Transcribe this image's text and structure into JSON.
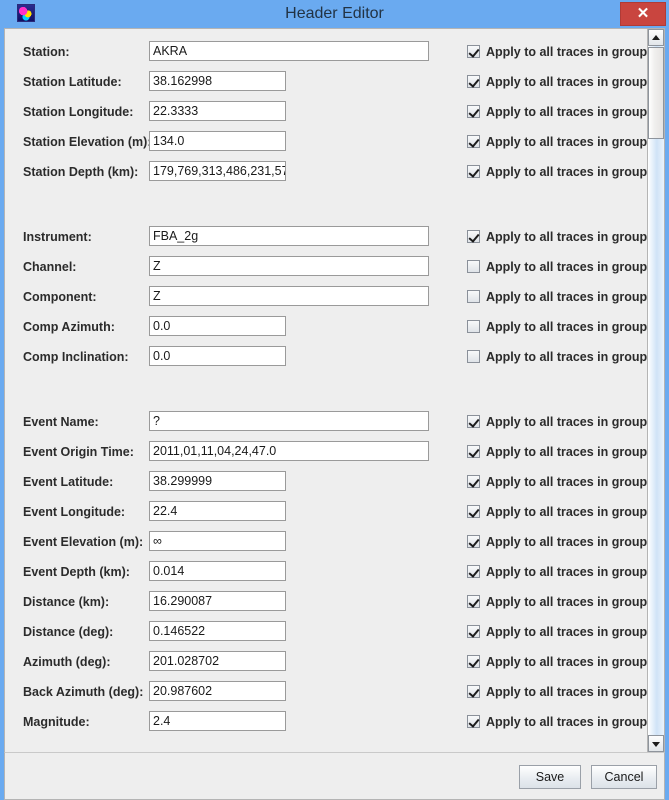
{
  "window": {
    "title": "Header Editor",
    "app_icon": "app-icon",
    "close_label": "✕"
  },
  "checkbox_label": "Apply to all traces in group",
  "sections": [
    {
      "name": "station",
      "rows": [
        {
          "label": "Station:",
          "value": "AKRA",
          "width": "wide",
          "checked": true
        },
        {
          "label": "Station Latitude:",
          "value": "38.162998",
          "width": "narrow",
          "checked": true
        },
        {
          "label": "Station Longitude:",
          "value": "22.3333",
          "width": "narrow",
          "checked": true
        },
        {
          "label": "Station Elevation (m):",
          "value": "134.0",
          "width": "narrow",
          "checked": true
        },
        {
          "label": "Station Depth (km):",
          "value": "179,769,313,486,231,57",
          "width": "narrow",
          "checked": true
        }
      ]
    },
    {
      "name": "instrument",
      "rows": [
        {
          "label": "Instrument:",
          "value": "FBA_2g",
          "width": "wide",
          "checked": true
        },
        {
          "label": "Channel:",
          "value": "Z",
          "width": "wide",
          "checked": false
        },
        {
          "label": "Component:",
          "value": "Z",
          "width": "wide",
          "checked": false
        },
        {
          "label": "Comp Azimuth:",
          "value": "0.0",
          "width": "narrow",
          "checked": false
        },
        {
          "label": "Comp Inclination:",
          "value": "0.0",
          "width": "narrow",
          "checked": false
        }
      ]
    },
    {
      "name": "event",
      "rows": [
        {
          "label": "Event Name:",
          "value": "?",
          "width": "wide",
          "checked": true
        },
        {
          "label": "Event Origin Time:",
          "value": "2011,01,11,04,24,47.0",
          "width": "wide",
          "checked": true
        },
        {
          "label": "Event Latitude:",
          "value": "38.299999",
          "width": "narrow",
          "checked": true
        },
        {
          "label": "Event Longitude:",
          "value": "22.4",
          "width": "narrow",
          "checked": true
        },
        {
          "label": "Event Elevation (m):",
          "value": "∞",
          "width": "narrow",
          "checked": true
        },
        {
          "label": "Event Depth (km):",
          "value": "0.014",
          "width": "narrow",
          "checked": true
        },
        {
          "label": "Distance (km):",
          "value": "16.290087",
          "width": "narrow",
          "checked": true
        },
        {
          "label": "Distance (deg):",
          "value": "0.146522",
          "width": "narrow",
          "checked": true
        },
        {
          "label": "Azimuth (deg):",
          "value": "201.028702",
          "width": "narrow",
          "checked": true
        },
        {
          "label": "Back Azimuth (deg):",
          "value": "20.987602",
          "width": "narrow",
          "checked": true
        },
        {
          "label": "Magnitude:",
          "value": "2.4",
          "width": "narrow",
          "checked": true
        }
      ]
    }
  ],
  "scrollbar": {
    "up_arrow": "scroll-up-arrow",
    "down_arrow": "scroll-down-arrow"
  },
  "buttons": {
    "save": "Save",
    "cancel": "Cancel"
  },
  "colors": {
    "window_frame": "#6aaaf0",
    "panel": "#eeeeee",
    "close_button": "#c9453f",
    "field_background": "#ffffff"
  }
}
